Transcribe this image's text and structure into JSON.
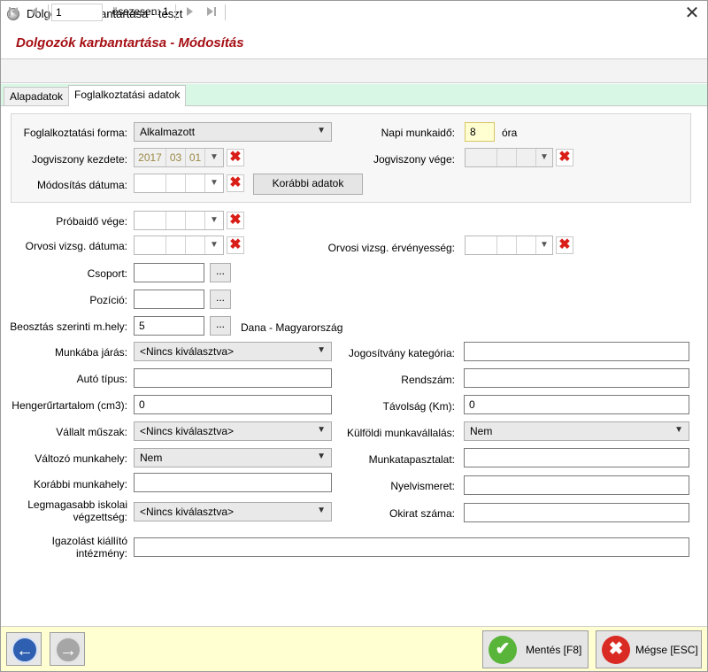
{
  "window": {
    "title": "Dolgozók karbantartása - teszt",
    "close_glyph": "✕",
    "header_title": "Dolgozók karbantartása - Módosítás"
  },
  "navigator": {
    "record": "1",
    "total_label": ", összesen: 1"
  },
  "tabs": [
    {
      "label": "Alapadatok"
    },
    {
      "label": "Foglalkoztatási adatok"
    }
  ],
  "form": {
    "employment_form": {
      "label": "Foglalkoztatási forma:",
      "value": "Alkalmazott"
    },
    "daily_hours": {
      "label": "Napi munkaidő:",
      "value": "8",
      "unit": "óra"
    },
    "start_date": {
      "label": "Jogviszony kezdete:",
      "year": "2017",
      "month": "03",
      "day": "01"
    },
    "end_date": {
      "label": "Jogviszony vége:"
    },
    "mod_date": {
      "label": "Módosítás dátuma:"
    },
    "previous_button": "Korábbi adatok",
    "probation_end": {
      "label": "Próbaidő vége:"
    },
    "medical_date": {
      "label": "Orvosi vizsg. dátuma:"
    },
    "medical_validity": {
      "label": "Orvosi vizsg. érvényesség:"
    },
    "group": {
      "label": "Csoport:",
      "value": ""
    },
    "position": {
      "label": "Pozíció:",
      "value": ""
    },
    "workplace": {
      "label": "Beosztás szerinti m.hely:",
      "value": "5",
      "description": "Dana - Magyarország"
    },
    "commute": {
      "label": "Munkába járás:",
      "value": "<Nincs kiválasztva>"
    },
    "license": {
      "label": "Jogosítvány kategória:",
      "value": ""
    },
    "car_type": {
      "label": "Autó típus:",
      "value": ""
    },
    "plate": {
      "label": "Rendszám:",
      "value": ""
    },
    "engine": {
      "label": "Hengerűrtartalom (cm3):",
      "value": "0"
    },
    "distance": {
      "label": "Távolság (Km):",
      "value": "0"
    },
    "shifts": {
      "label": "Vállalt műszak:",
      "value": "<Nincs kiválasztva>"
    },
    "abroad": {
      "label": "Külföldi munkavállalás:",
      "value": "Nem"
    },
    "variable_workplace": {
      "label": "Változó munkahely:",
      "value": "Nem"
    },
    "experience": {
      "label": "Munkatapasztalat:",
      "value": ""
    },
    "previous_workplace": {
      "label": "Korábbi munkahely:",
      "value": ""
    },
    "languages": {
      "label": "Nyelvismeret:",
      "value": ""
    },
    "education": {
      "label_line1": "Legmagasabb iskolai",
      "label_line2": "végzettség:",
      "value": "<Nincs kiválasztva>"
    },
    "certificate_no": {
      "label": "Okirat száma:",
      "value": ""
    },
    "institution": {
      "label_line1": "Igazolást kiállító",
      "label_line2": "intézmény:",
      "value": ""
    }
  },
  "footer": {
    "save": "Mentés [F8]",
    "cancel": "Mégse [ESC]"
  }
}
